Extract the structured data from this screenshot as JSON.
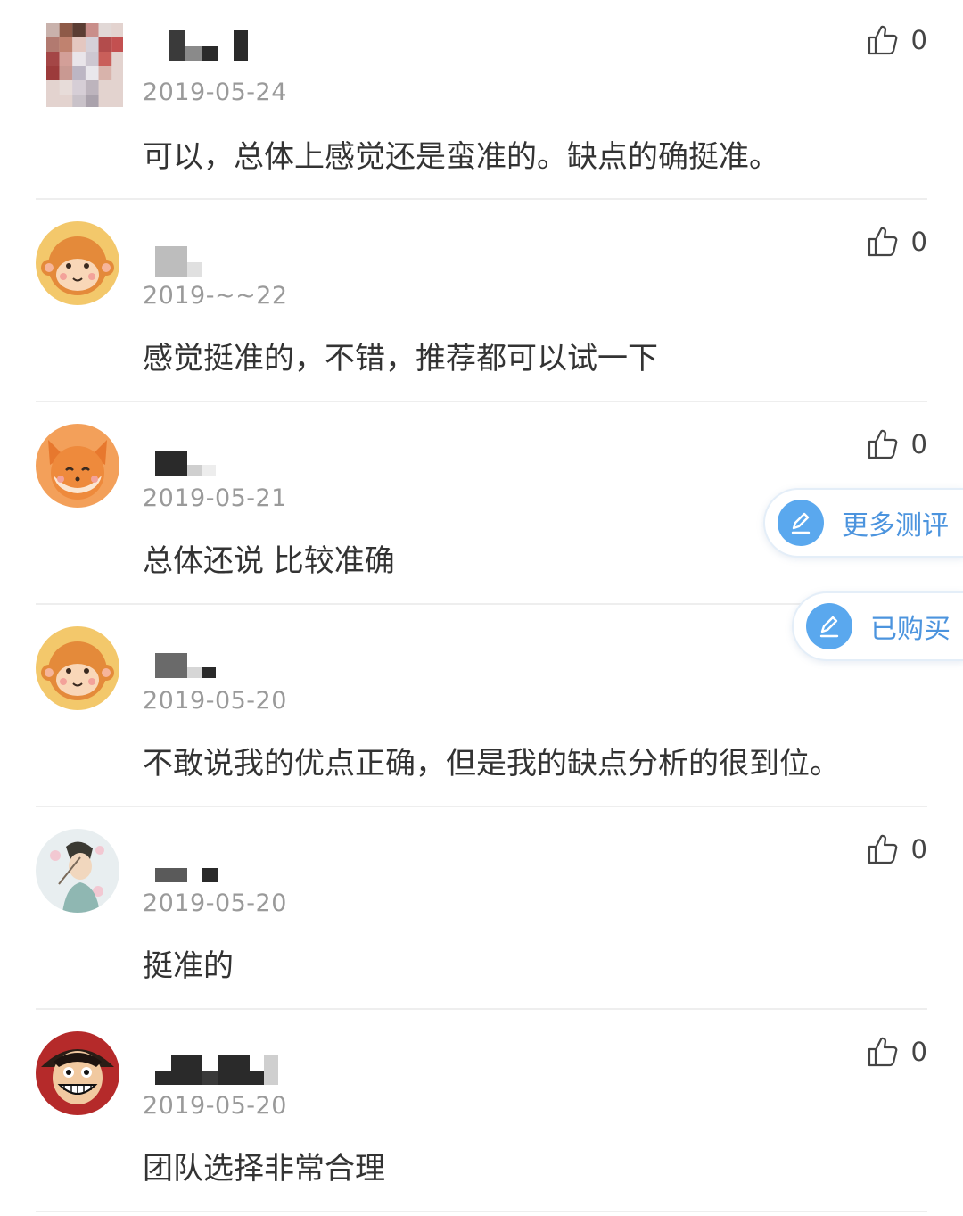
{
  "comments": [
    {
      "date": "2019-05-24",
      "text": "可以，总体上感觉还是蛮准的。缺点的确挺准。",
      "likes": "0",
      "avatar": "pixelated-photo"
    },
    {
      "date": "2019-~~22",
      "text": "感觉挺准的，不错，推荐都可以试一下",
      "likes": "0",
      "avatar": "monkey-cartoon"
    },
    {
      "date": "2019-05-21",
      "text": "总体还说 比较准确",
      "likes": "0",
      "avatar": "fox-cartoon"
    },
    {
      "date": "2019-05-20",
      "text": "不敢说我的优点正确，但是我的缺点分析的很到位。",
      "likes": "",
      "avatar": "monkey-cartoon"
    },
    {
      "date": "2019-05-20",
      "text": "挺准的",
      "likes": "0",
      "avatar": "anime-character"
    },
    {
      "date": "2019-05-20",
      "text": "团队选择非常合理",
      "likes": "0",
      "avatar": "luffy-cartoon"
    }
  ],
  "floating": {
    "more_reviews": "更多测评",
    "purchased": "已购买"
  },
  "colors": {
    "accent": "#5aa8ee",
    "accent_text": "#4c94de",
    "date": "#9a9a9a",
    "divider": "#eeeeee"
  },
  "icons": {
    "like": "thumbs-up-icon",
    "edit": "pencil-icon"
  }
}
